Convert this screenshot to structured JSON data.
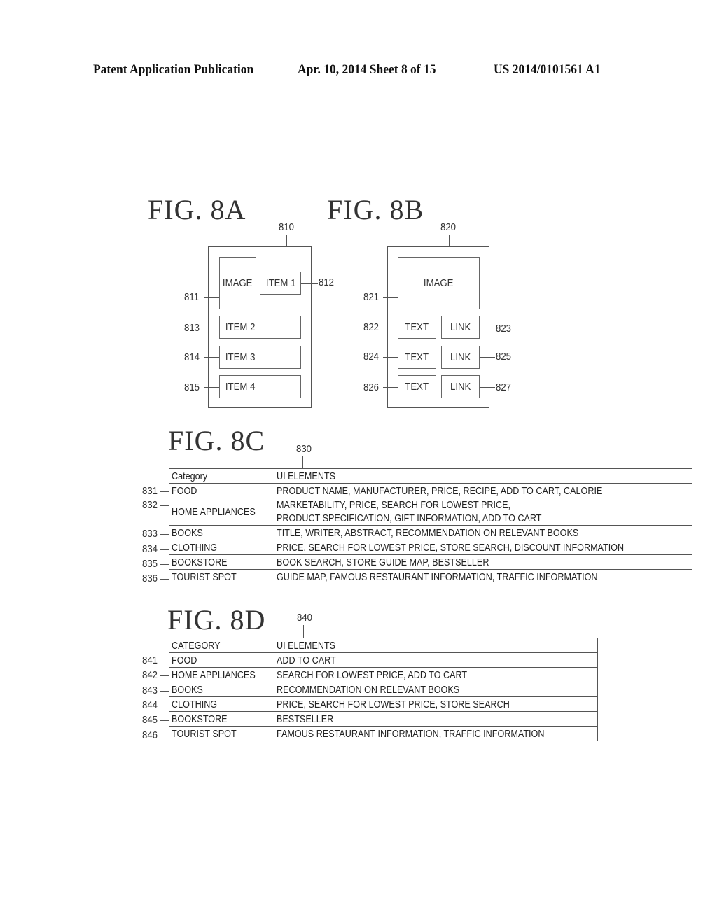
{
  "header": {
    "publication": "Patent Application Publication",
    "date_sheet": "Apr. 10, 2014  Sheet 8 of 15",
    "number": "US 2014/0101561 A1"
  },
  "fig8a": {
    "title": "FIG.  8A",
    "ref": "810",
    "image": {
      "label": "IMAGE",
      "ref": "811"
    },
    "items": [
      {
        "label": "ITEM 1",
        "ref": "812"
      },
      {
        "label": "ITEM 2",
        "ref": "813"
      },
      {
        "label": "ITEM 3",
        "ref": "814"
      },
      {
        "label": "ITEM 4",
        "ref": "815"
      }
    ]
  },
  "fig8b": {
    "title": "FIG.  8B",
    "ref": "820",
    "image": {
      "label": "IMAGE",
      "ref": "821"
    },
    "rows": [
      {
        "text": "TEXT",
        "text_ref": "822",
        "link": "LINK",
        "link_ref": "823"
      },
      {
        "text": "TEXT",
        "text_ref": "824",
        "link": "LINK",
        "link_ref": "825"
      },
      {
        "text": "TEXT",
        "text_ref": "826",
        "link": "LINK",
        "link_ref": "827"
      }
    ]
  },
  "fig8c": {
    "title": "FIG.  8C",
    "ref": "830",
    "headers": [
      "Category",
      "UI ELEMENTS"
    ],
    "rows": [
      {
        "ref": "831",
        "category": "FOOD",
        "elements": [
          "PRODUCT NAME, MANUFACTURER, PRICE, RECIPE, ADD TO CART, CALORIE"
        ]
      },
      {
        "ref": "832",
        "category": "HOME APPLIANCES",
        "elements": [
          "MARKETABILITY, PRICE, SEARCH FOR LOWEST PRICE,",
          "PRODUCT SPECIFICATION, GIFT INFORMATION, ADD TO CART"
        ]
      },
      {
        "ref": "833",
        "category": "BOOKS",
        "elements": [
          "TITLE, WRITER, ABSTRACT, RECOMMENDATION ON RELEVANT BOOKS"
        ]
      },
      {
        "ref": "834",
        "category": "CLOTHING",
        "elements": [
          "PRICE, SEARCH FOR LOWEST PRICE, STORE SEARCH, DISCOUNT INFORMATION"
        ]
      },
      {
        "ref": "835",
        "category": "BOOKSTORE",
        "elements": [
          "BOOK SEARCH, STORE GUIDE MAP, BESTSELLER"
        ]
      },
      {
        "ref": "836",
        "category": "TOURIST SPOT",
        "elements": [
          "GUIDE MAP, FAMOUS RESTAURANT INFORMATION, TRAFFIC INFORMATION"
        ]
      }
    ]
  },
  "fig8d": {
    "title": "FIG.  8D",
    "ref": "840",
    "headers": [
      "CATEGORY",
      "UI ELEMENTS"
    ],
    "rows": [
      {
        "ref": "841",
        "category": "FOOD",
        "elements": [
          "ADD TO CART"
        ]
      },
      {
        "ref": "842",
        "category": "HOME APPLIANCES",
        "elements": [
          "SEARCH FOR LOWEST PRICE, ADD TO CART"
        ]
      },
      {
        "ref": "843",
        "category": "BOOKS",
        "elements": [
          "RECOMMENDATION ON RELEVANT BOOKS"
        ]
      },
      {
        "ref": "844",
        "category": "CLOTHING",
        "elements": [
          "PRICE, SEARCH FOR LOWEST PRICE, STORE SEARCH"
        ]
      },
      {
        "ref": "845",
        "category": "BOOKSTORE",
        "elements": [
          "BESTSELLER"
        ]
      },
      {
        "ref": "846",
        "category": "TOURIST SPOT",
        "elements": [
          "FAMOUS RESTAURANT INFORMATION, TRAFFIC INFORMATION"
        ]
      }
    ]
  }
}
